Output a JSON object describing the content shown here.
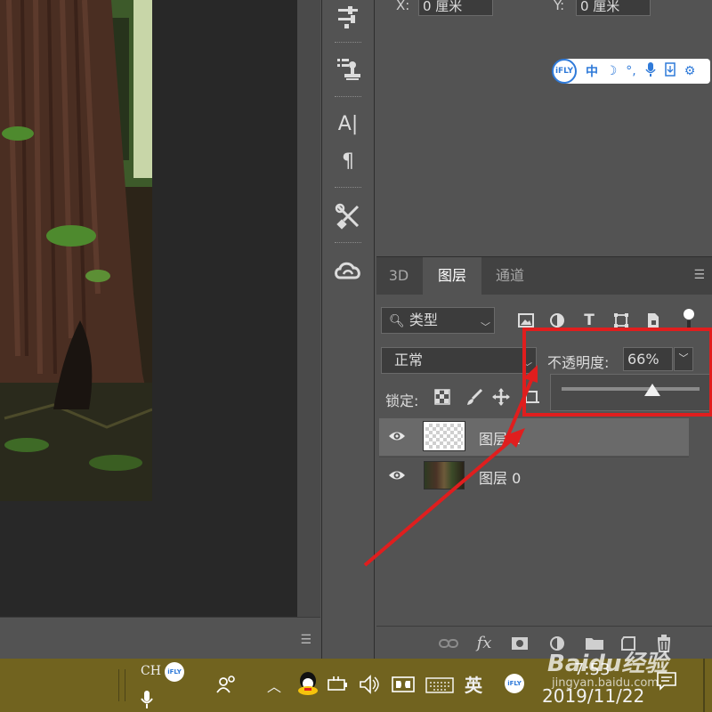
{
  "colors": {
    "annotation_red": "#e01e1e",
    "panel_bg": "#535353",
    "taskbar_bg": "#71631f",
    "ifly_blue": "#2f7ad9"
  },
  "properties": {
    "x_label": "X:",
    "x_value": "0 厘米",
    "y_label": "Y:",
    "y_value": "0 厘米"
  },
  "ime_bar": {
    "logo": "iFLY",
    "items": [
      "中",
      "☽",
      "°,",
      "mic-icon",
      "keyboard-icon",
      "gear-icon"
    ],
    "lang": "中"
  },
  "tool_strip": {
    "icons": [
      "adjust-sliders-icon",
      "clone-stamp-list-icon",
      "character-icon",
      "paragraph-icon",
      "tools-icon",
      "creative-cloud-icon"
    ],
    "character_label": "A|",
    "paragraph_label": "¶"
  },
  "layers_panel": {
    "tabs": [
      {
        "label": "3D",
        "active": false
      },
      {
        "label": "图层",
        "active": true
      },
      {
        "label": "通道",
        "active": false
      }
    ],
    "filter_label": "类型",
    "blend_mode": "正常",
    "opacity_label": "不透明度:",
    "opacity_value": "66%",
    "opacity_slider": 0.66,
    "lock_label": "锁定:",
    "layers": [
      {
        "name": "图层 2",
        "visible": true,
        "selected": true,
        "thumb": "transparent"
      },
      {
        "name": "图层 0",
        "visible": true,
        "selected": false,
        "thumb": "photo"
      }
    ]
  },
  "taskbar": {
    "lang": "CH",
    "ime_mode": "英",
    "time": "7:53",
    "date": "2019/11/22"
  },
  "watermark": {
    "text": "Baidu经验",
    "sub": "jingyan.baidu.com"
  }
}
